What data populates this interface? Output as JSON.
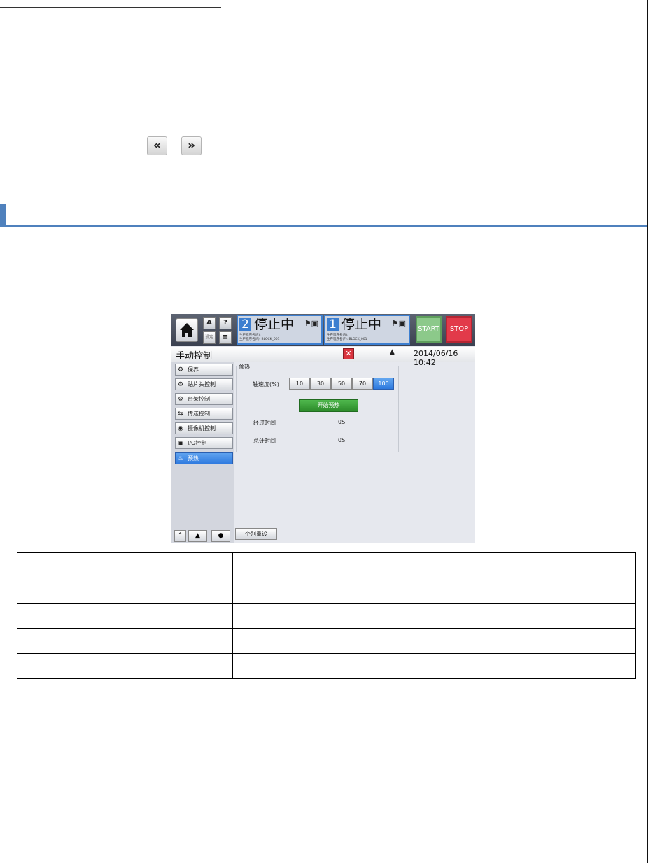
{
  "nav": {
    "prev_icon": "double-left-chevron",
    "next_icon": "double-right-chevron",
    "prev_glyph": "«",
    "next_glyph": "»"
  },
  "accent_color": "#4f81bd",
  "hmi": {
    "header": {
      "home_icon": "home-icon",
      "small_buttons": [
        "A",
        "?",
        "设定",
        "≡"
      ],
      "lanes": [
        {
          "number": "2",
          "status": "停止中",
          "line1": "生产程序名(R):",
          "line2": "生产程序名(F): BLOCK_001"
        },
        {
          "number": "1",
          "status": "停止中",
          "line1": "生产程序名(R):",
          "line2": "生产程序名(F): BLOCK_001"
        }
      ],
      "start_label": "START",
      "stop_label": "STOP"
    },
    "title": "手动控制",
    "close_glyph": "✕",
    "user_icon": "user-icon",
    "user_glyph": "♟",
    "datetime": "2014/06/16 10:42",
    "sidebar": {
      "items": [
        {
          "label": "保养",
          "icon": "maintenance-icon",
          "glyph": "⚙"
        },
        {
          "label": "贴片头控制",
          "icon": "head-icon",
          "glyph": "⚙"
        },
        {
          "label": "台架控制",
          "icon": "table-icon",
          "glyph": "⚙"
        },
        {
          "label": "传送控制",
          "icon": "conveyor-icon",
          "glyph": "⇆"
        },
        {
          "label": "摄像机控制",
          "icon": "camera-icon",
          "glyph": "◉"
        },
        {
          "label": "I/O控制",
          "icon": "io-icon",
          "glyph": "▣"
        },
        {
          "label": "预热",
          "icon": "preheat-icon",
          "glyph": "♨"
        }
      ],
      "active_index": 6,
      "bottom_icons": [
        {
          "name": "collapse-icon",
          "glyph": "⌃"
        },
        {
          "name": "warning-icon",
          "glyph": "▲"
        },
        {
          "name": "info-icon",
          "glyph": "●"
        }
      ]
    },
    "panel": {
      "group_label": "预热",
      "speed_label": "轴速度(%)",
      "speed_options": [
        "10",
        "30",
        "50",
        "70",
        "100"
      ],
      "speed_selected": "100",
      "start_button": "开始预热",
      "elapsed_label": "经过时间",
      "elapsed_value": "0S",
      "total_label": "总计时间",
      "total_value": "0S",
      "reset_button": "个别重设"
    }
  },
  "table": {
    "rows": [
      [
        "",
        "",
        ""
      ],
      [
        "",
        "",
        ""
      ],
      [
        "",
        "",
        ""
      ],
      [
        "",
        "",
        ""
      ],
      [
        "",
        "",
        ""
      ]
    ]
  }
}
